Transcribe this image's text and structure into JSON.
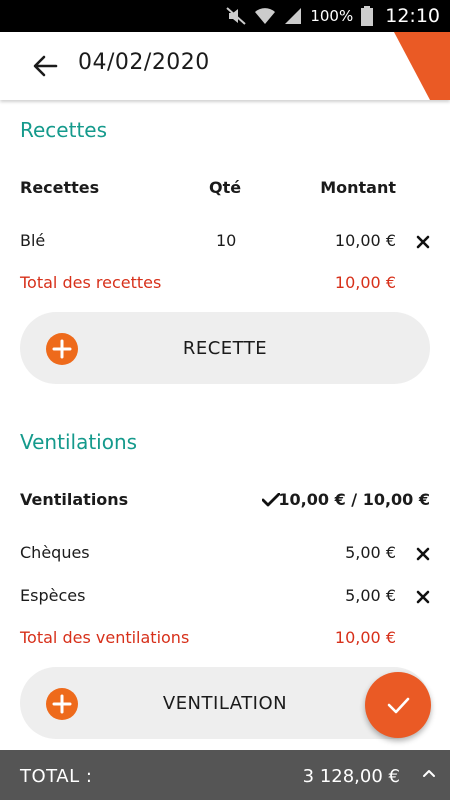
{
  "status_bar": {
    "battery": "100%",
    "time": "12:10"
  },
  "header": {
    "title": "04/02/2020"
  },
  "recettes": {
    "section_title": "Recettes",
    "columns": {
      "name": "Recettes",
      "qty": "Qté",
      "amount": "Montant"
    },
    "rows": [
      {
        "name": "Blé",
        "qty": "10",
        "amount": "10,00 €"
      }
    ],
    "total_label": "Total des recettes",
    "total_value": "10,00 €",
    "add_label": "RECETTE"
  },
  "ventilations": {
    "section_title": "Ventilations",
    "header_label": "Ventilations",
    "header_value": "10,00 € / 10,00 €",
    "rows": [
      {
        "name": "Chèques",
        "amount": "5,00 €"
      },
      {
        "name": "Espèces",
        "amount": "5,00 €"
      }
    ],
    "total_label": "Total des ventilations",
    "total_value": "10,00 €",
    "add_label": "VENTILATION"
  },
  "footer": {
    "total_label": "TOTAL :",
    "total_value": "3 128,00 €"
  },
  "colors": {
    "accent_teal": "#159a8c",
    "accent_orange": "#ee6a1b",
    "total_red": "#d7301a",
    "footer_bg": "#555555"
  },
  "icons": [
    "back-arrow-icon",
    "close-icon",
    "plus-icon",
    "check-icon",
    "chevron-up-icon",
    "wifi-icon",
    "signal-icon",
    "battery-icon",
    "mute-icon"
  ]
}
